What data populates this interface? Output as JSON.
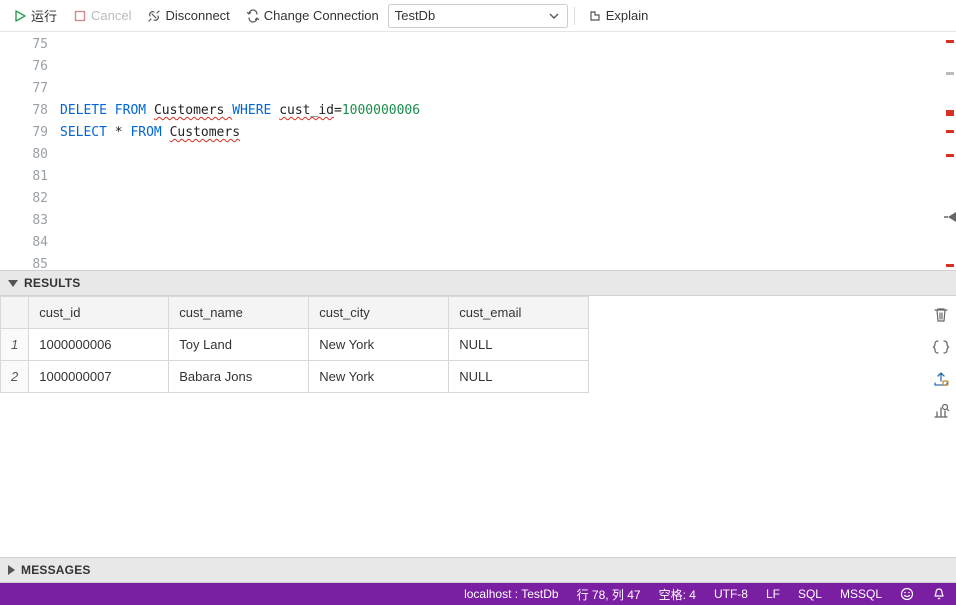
{
  "toolbar": {
    "run_label": "运行",
    "cancel_label": "Cancel",
    "disconnect_label": "Disconnect",
    "change_connection_label": "Change Connection",
    "connection_selected": "TestDb",
    "explain_label": "Explain"
  },
  "editor": {
    "line_start": 75,
    "line_end": 85,
    "lines": {
      "78": {
        "tokens": [
          {
            "t": "DELETE ",
            "cls": "kw"
          },
          {
            "t": "FROM ",
            "cls": "kw"
          },
          {
            "t": "Customers ",
            "cls": "plain wavy"
          },
          {
            "t": "WHERE ",
            "cls": "kw"
          },
          {
            "t": "cust_id",
            "cls": "plain wavy"
          },
          {
            "t": "=",
            "cls": "plain"
          },
          {
            "t": "1000000006",
            "cls": "num"
          }
        ]
      },
      "79": {
        "tokens": [
          {
            "t": "SELECT ",
            "cls": "kw"
          },
          {
            "t": "* ",
            "cls": "plain"
          },
          {
            "t": "FROM ",
            "cls": "kw"
          },
          {
            "t": "Customers",
            "cls": "plain wavy"
          }
        ]
      }
    }
  },
  "panels": {
    "results_label": "RESULTS",
    "messages_label": "MESSAGES"
  },
  "results": {
    "columns": [
      "cust_id",
      "cust_name",
      "cust_city",
      "cust_email"
    ],
    "rows": [
      {
        "n": "1",
        "cells": [
          "1000000006",
          "Toy Land",
          "New York",
          "NULL"
        ]
      },
      {
        "n": "2",
        "cells": [
          "1000000007",
          "Babara Jons",
          "New York",
          "NULL"
        ]
      }
    ]
  },
  "status": {
    "connection": "localhost : TestDb",
    "position": "行 78,  列 47",
    "spaces": "空格: 4",
    "encoding": "UTF-8",
    "eol": "LF",
    "lang": "SQL",
    "dialect": "MSSQL"
  }
}
